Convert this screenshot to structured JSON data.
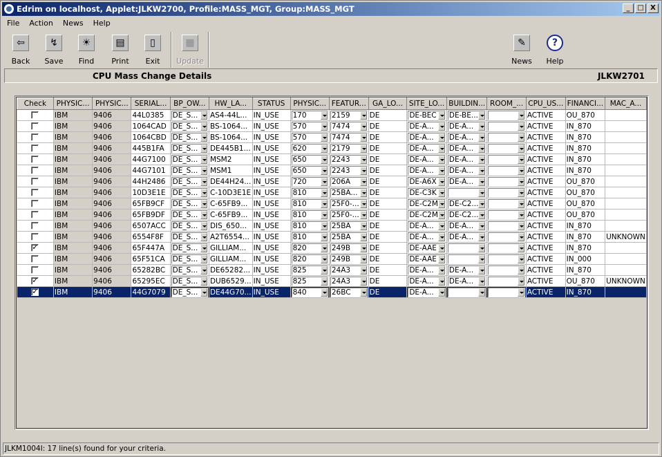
{
  "window": {
    "title": "Edrim on localhost, Applet:JLKW2700, Profile:MASS_MGT, Group:MASS_MGT",
    "minimize": "_",
    "maximize": "□",
    "close": "X"
  },
  "menu": [
    "File",
    "Action",
    "News",
    "Help"
  ],
  "toolbar": {
    "back": "Back",
    "save": "Save",
    "find": "Find",
    "print": "Print",
    "exit": "Exit",
    "update": "Update",
    "news": "News",
    "help": "Help"
  },
  "header": {
    "title": "CPU Mass Change Details",
    "screen_id": "JLKW2701"
  },
  "table": {
    "columns": [
      "Check",
      "PHYSIC...",
      "PHYSIC...",
      "SERIAL...",
      "BP_OW...",
      "HW_LA...",
      "STATUS",
      "PHYSIC...",
      "FEATUR...",
      "GA_LO...",
      "SITE_LO...",
      "BUILDIN...",
      "ROOM_...",
      "CPU_US...",
      "FINANCI...",
      "MAC_A..."
    ],
    "rows": [
      {
        "checked": false,
        "c1": "IBM",
        "c2": "9406",
        "c3": "44L0385",
        "c4": "DE_S...",
        "c5": "AS4-44L...",
        "c6": "IN_USE",
        "c7": "170",
        "c8": "2159",
        "c9": "DE",
        "c10": "DE-BEC",
        "c11": "DE-BE...",
        "c12": "",
        "c13": "ACTIVE",
        "c14": "OU_870",
        "c15": ""
      },
      {
        "checked": false,
        "c1": "IBM",
        "c2": "9406",
        "c3": "1064CAD",
        "c4": "DE_S...",
        "c5": "BS-1064...",
        "c6": "IN_USE",
        "c7": "570",
        "c8": "7474",
        "c9": "DE",
        "c10": "DE-A...",
        "c11": "DE-A...",
        "c12": "",
        "c13": "ACTIVE",
        "c14": "IN_870",
        "c15": ""
      },
      {
        "checked": false,
        "c1": "IBM",
        "c2": "9406",
        "c3": "1064CBD",
        "c4": "DE_S...",
        "c5": "BS-1064...",
        "c6": "IN_USE",
        "c7": "570",
        "c8": "7474",
        "c9": "DE",
        "c10": "DE-A...",
        "c11": "DE-A...",
        "c12": "",
        "c13": "ACTIVE",
        "c14": "IN_870",
        "c15": ""
      },
      {
        "checked": false,
        "c1": "IBM",
        "c2": "9406",
        "c3": "445B1FA",
        "c4": "DE_S...",
        "c5": "DE445B1...",
        "c6": "IN_USE",
        "c7": "620",
        "c8": "2179",
        "c9": "DE",
        "c10": "DE-A...",
        "c11": "DE-A...",
        "c12": "",
        "c13": "ACTIVE",
        "c14": "IN_870",
        "c15": ""
      },
      {
        "checked": false,
        "c1": "IBM",
        "c2": "9406",
        "c3": "44G7100",
        "c4": "DE_S...",
        "c5": "MSM2",
        "c6": "IN_USE",
        "c7": "650",
        "c8": "2243",
        "c9": "DE",
        "c10": "DE-A...",
        "c11": "DE-A...",
        "c12": "",
        "c13": "ACTIVE",
        "c14": "IN_870",
        "c15": ""
      },
      {
        "checked": false,
        "c1": "IBM",
        "c2": "9406",
        "c3": "44G7101",
        "c4": "DE_S...",
        "c5": "MSM1",
        "c6": "IN_USE",
        "c7": "650",
        "c8": "2243",
        "c9": "DE",
        "c10": "DE-A...",
        "c11": "DE-A...",
        "c12": "",
        "c13": "ACTIVE",
        "c14": "IN_870",
        "c15": ""
      },
      {
        "checked": false,
        "c1": "IBM",
        "c2": "9406",
        "c3": "44H2486",
        "c4": "DE_S...",
        "c5": "DE44H24...",
        "c6": "IN_USE",
        "c7": "720",
        "c8": "206A",
        "c9": "DE",
        "c10": "DE-A6X",
        "c11": "DE-A...",
        "c12": "",
        "c13": "ACTIVE",
        "c14": "OU_870",
        "c15": ""
      },
      {
        "checked": false,
        "c1": "IBM",
        "c2": "9406",
        "c3": "10D3E1E",
        "c4": "DE_S...",
        "c5": "C-10D3E1E",
        "c6": "IN_USE",
        "c7": "810",
        "c8": "25BA...",
        "c9": "DE",
        "c10": "DE-C3K",
        "c11": "",
        "c12": "",
        "c13": "ACTIVE",
        "c14": "OU_870",
        "c15": ""
      },
      {
        "checked": false,
        "c1": "IBM",
        "c2": "9406",
        "c3": "65FB9CF",
        "c4": "DE_S...",
        "c5": "C-65FB9...",
        "c6": "IN_USE",
        "c7": "810",
        "c8": "25F0-...",
        "c9": "DE",
        "c10": "DE-C2M",
        "c11": "DE-C2...",
        "c12": "",
        "c13": "ACTIVE",
        "c14": "OU_870",
        "c15": ""
      },
      {
        "checked": false,
        "c1": "IBM",
        "c2": "9406",
        "c3": "65FB9DF",
        "c4": "DE_S...",
        "c5": "C-65FB9...",
        "c6": "IN_USE",
        "c7": "810",
        "c8": "25F0-...",
        "c9": "DE",
        "c10": "DE-C2M",
        "c11": "DE-C2...",
        "c12": "",
        "c13": "ACTIVE",
        "c14": "OU_870",
        "c15": ""
      },
      {
        "checked": false,
        "c1": "IBM",
        "c2": "9406",
        "c3": "6507ACC",
        "c4": "DE_S...",
        "c5": "DIS_650...",
        "c6": "IN_USE",
        "c7": "810",
        "c8": "25BA",
        "c9": "DE",
        "c10": "DE-A...",
        "c11": "DE-A...",
        "c12": "",
        "c13": "ACTIVE",
        "c14": "IN_870",
        "c15": ""
      },
      {
        "checked": false,
        "c1": "IBM",
        "c2": "9406",
        "c3": "6554F8F",
        "c4": "DE_S...",
        "c5": "A2T6554...",
        "c6": "IN_USE",
        "c7": "810",
        "c8": "25BA",
        "c9": "DE",
        "c10": "DE-A...",
        "c11": "DE-A...",
        "c12": "",
        "c13": "ACTIVE",
        "c14": "IN_870",
        "c15": "UNKNOWN"
      },
      {
        "checked": true,
        "c1": "IBM",
        "c2": "9406",
        "c3": "65F447A",
        "c4": "DE_S...",
        "c5": "GILLIAM...",
        "c6": "IN_USE",
        "c7": "820",
        "c8": "249B",
        "c9": "DE",
        "c10": "DE-AAE",
        "c11": "",
        "c12": "",
        "c13": "ACTIVE",
        "c14": "IN_870",
        "c15": ""
      },
      {
        "checked": false,
        "c1": "IBM",
        "c2": "9406",
        "c3": "65F51CA",
        "c4": "DE_S...",
        "c5": "GILLIAM...",
        "c6": "IN_USE",
        "c7": "820",
        "c8": "249B",
        "c9": "DE",
        "c10": "DE-AAE",
        "c11": "",
        "c12": "",
        "c13": "ACTIVE",
        "c14": "IN_000",
        "c15": ""
      },
      {
        "checked": false,
        "c1": "IBM",
        "c2": "9406",
        "c3": "65282BC",
        "c4": "DE_S...",
        "c5": "DE65282...",
        "c6": "IN_USE",
        "c7": "825",
        "c8": "24A3",
        "c9": "DE",
        "c10": "DE-A...",
        "c11": "DE-A...",
        "c12": "",
        "c13": "ACTIVE",
        "c14": "IN_870",
        "c15": ""
      },
      {
        "checked": true,
        "c1": "IBM",
        "c2": "9406",
        "c3": "65295EC",
        "c4": "DE_S...",
        "c5": "DUB6529...",
        "c6": "IN_USE",
        "c7": "825",
        "c8": "24A3",
        "c9": "DE",
        "c10": "DE-A...",
        "c11": "DE-A...",
        "c12": "",
        "c13": "ACTIVE",
        "c14": "OU_870",
        "c15": "UNKNOWN"
      },
      {
        "checked": true,
        "selected": true,
        "c1": "IBM",
        "c2": "9406",
        "c3": "44G7079",
        "c4": "DE_S...",
        "c5": "DE44G70...",
        "c6": "IN_USE",
        "c7": "840",
        "c8": "26BC",
        "c9": "DE",
        "c10": "DE-A...",
        "c11": "",
        "c12": "",
        "c13": "ACTIVE",
        "c14": "IN_870",
        "c15": ""
      }
    ]
  },
  "status": "JLKM1004I: 17 line(s) found for your criteria."
}
